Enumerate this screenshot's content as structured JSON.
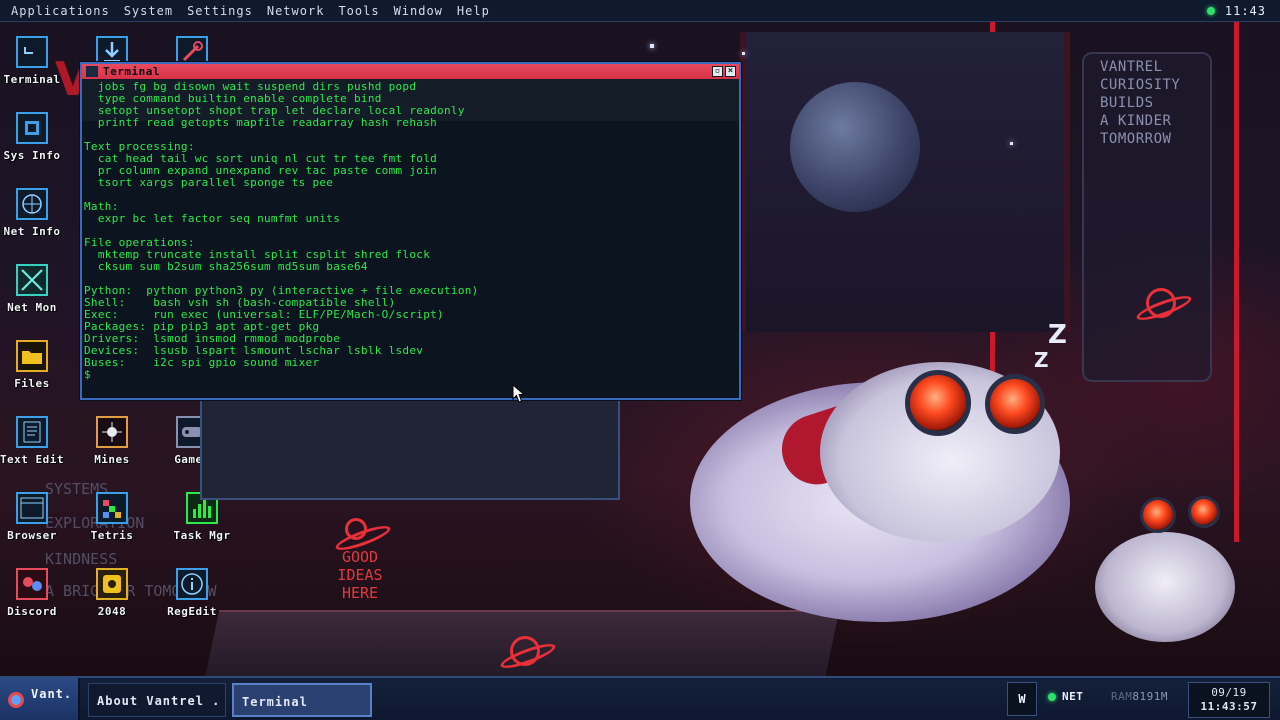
{
  "menubar": {
    "items": [
      "Applications",
      "System",
      "Settings",
      "Network",
      "Tools",
      "Window",
      "Help"
    ],
    "clock": "11:43"
  },
  "wallpaper": {
    "logo_text": "VANTREL",
    "panel_text": "VANTREL\nCURIOSITY\nBUILDS\nA KINDER\nTOMORROW",
    "sign_text": "GOOD\nIDEAS\nHERE",
    "wall_words": [
      "SYSTEMS",
      "EXPLORATION",
      "KINDNESS",
      "A BRIGHTER TOMORROW"
    ]
  },
  "desktop_icons": [
    {
      "label": "Terminal",
      "icon": "terminal-icon"
    },
    {
      "label": "Sys Info",
      "icon": "chip-icon"
    },
    {
      "label": "Net Info",
      "icon": "globe-icon"
    },
    {
      "label": "Net Mon",
      "icon": "network-monitor-icon"
    },
    {
      "label": "Files",
      "icon": "folder-icon"
    },
    {
      "label": "Text Edit",
      "icon": "text-edit-icon"
    },
    {
      "label": "Mines",
      "icon": "mines-icon"
    },
    {
      "label": "Games",
      "icon": "gamepad-icon"
    },
    {
      "label": "Browser",
      "icon": "browser-icon"
    },
    {
      "label": "Tetris",
      "icon": "tetris-icon"
    },
    {
      "label": "Task Mgr",
      "icon": "task-manager-icon"
    },
    {
      "label": "Discord",
      "icon": "discord-icon"
    },
    {
      "label": "2048",
      "icon": "puzzle-icon"
    },
    {
      "label": "RegEdit",
      "icon": "info-icon"
    },
    {
      "label": "",
      "icon": "download-icon"
    },
    {
      "label": "",
      "icon": "wrench-icon"
    }
  ],
  "terminal": {
    "title": "Terminal",
    "lines": [
      "  jobs fg bg disown wait suspend dirs pushd popd",
      "  type command builtin enable complete bind",
      "  setopt unsetopt shopt trap let declare local readonly",
      "  printf read getopts mapfile readarray hash rehash",
      "",
      "Text processing:",
      "  cat head tail wc sort uniq nl cut tr tee fmt fold",
      "  pr column expand unexpand rev tac paste comm join",
      "  tsort xargs parallel sponge ts pee",
      "",
      "Math:",
      "  expr bc let factor seq numfmt units",
      "",
      "File operations:",
      "  mktemp truncate install split csplit shred flock",
      "  cksum sum b2sum sha256sum md5sum base64",
      "",
      "Python:  python python3 py (interactive + file execution)",
      "Shell:    bash vsh sh (bash-compatible shell)",
      "Exec:     run exec (universal: ELF/PE/Mach-O/script)",
      "Packages: pip pip3 apt apt-get pkg",
      "Drivers:  lsmod insmod rmmod modprobe",
      "Devices:  lsusb lspart lsmount lschar lsblk lsdev",
      "Buses:    i2c spi gpio sound mixer",
      "$"
    ]
  },
  "taskbar": {
    "start_label": "Vant.",
    "tasks": [
      "About Vantrel .",
      "Terminal"
    ],
    "tray_w": "W",
    "net_label": "NET",
    "ram_label": "RAM",
    "ram_value": "8191M",
    "date": "09/19",
    "time": "11:43:57"
  },
  "colors": {
    "terminal_text": "#2ee84a",
    "titlebar": "#e84a5e",
    "accent": "#3a6ac0",
    "status_green": "#2fe06a"
  }
}
